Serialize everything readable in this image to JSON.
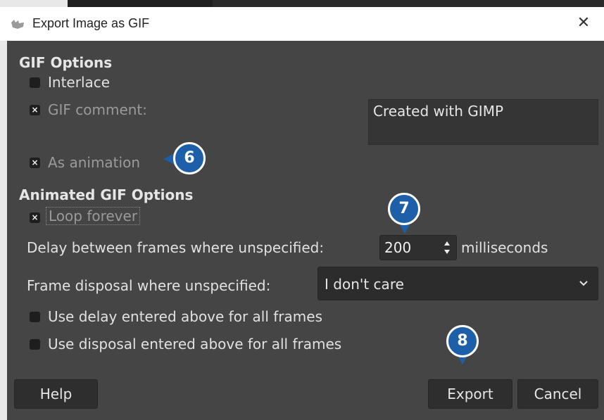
{
  "window": {
    "title": "Export Image as GIF",
    "close_glyph": "✕"
  },
  "gif_options": {
    "heading": "GIF Options",
    "interlace": {
      "label": "Interlace",
      "checked": false
    },
    "gif_comment": {
      "label": "GIF comment:",
      "checked": true,
      "value": "Created with GIMP"
    },
    "as_animation": {
      "label": "As animation",
      "checked": true
    }
  },
  "animated": {
    "heading": "Animated GIF Options",
    "loop_forever": {
      "label": "Loop forever",
      "checked": true
    },
    "delay": {
      "label": "Delay between frames where unspecified:",
      "value": "200",
      "unit": "milliseconds"
    },
    "disposal": {
      "label": "Frame disposal where unspecified:",
      "value": "I don't care"
    },
    "use_delay": {
      "label": "Use delay entered above for all frames",
      "checked": false
    },
    "use_disposal": {
      "label": "Use disposal entered above for all frames",
      "checked": false
    }
  },
  "buttons": {
    "help": "Help",
    "export": "Export",
    "cancel": "Cancel"
  },
  "callouts": [
    "6",
    "7",
    "8"
  ],
  "check_glyph": "×",
  "colors": {
    "callout": "#1d5fa8",
    "dialog_bg": "#454545"
  }
}
